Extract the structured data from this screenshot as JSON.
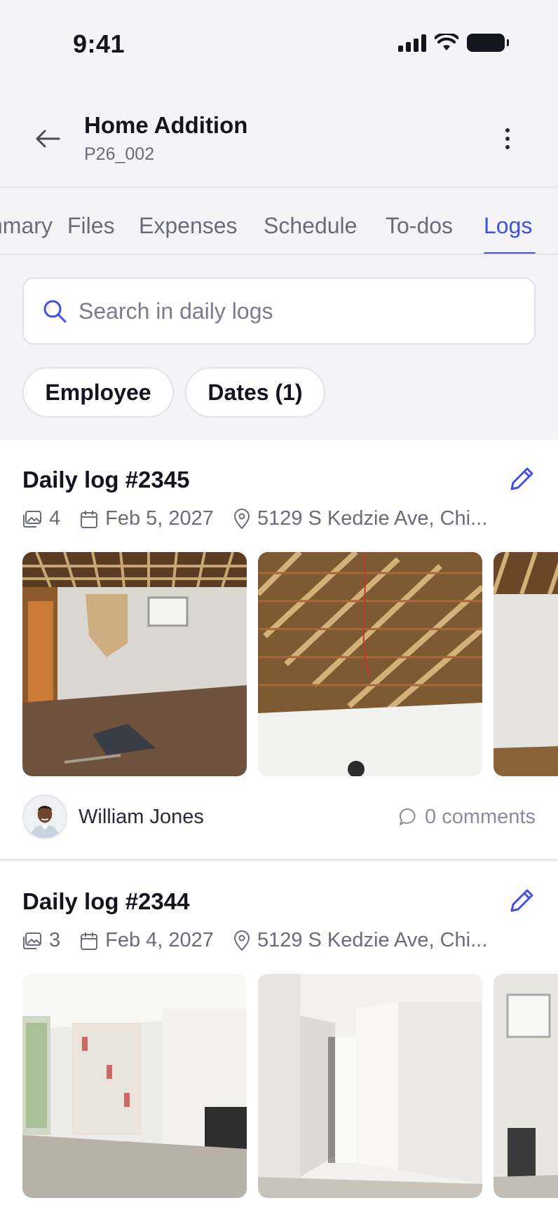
{
  "status_bar": {
    "time": "9:41"
  },
  "header": {
    "title": "Home Addition",
    "subtitle": "P26_002"
  },
  "tabs": [
    {
      "label": "Summary",
      "active": false
    },
    {
      "label": "Files",
      "active": false
    },
    {
      "label": "Expenses",
      "active": false
    },
    {
      "label": "Schedule",
      "active": false
    },
    {
      "label": "To-dos",
      "active": false
    },
    {
      "label": "Logs",
      "active": true
    }
  ],
  "search": {
    "placeholder": "Search in daily logs",
    "value": ""
  },
  "filters": {
    "employee_label": "Employee",
    "dates_label": "Dates (1)"
  },
  "logs": [
    {
      "title": "Daily log #2345",
      "photo_count": "4",
      "date": "Feb 5, 2027",
      "address": "5129 S Kedzie Ave, Chi...",
      "author": "William Jones",
      "comments": "0 comments"
    },
    {
      "title": "Daily log #2344",
      "photo_count": "3",
      "date": "Feb 4, 2027",
      "address": "5129 S Kedzie Ave, Chi..."
    }
  ],
  "colors": {
    "accent": "#4150e0",
    "muted_text": "#6b6c7b",
    "background": "#f3f3f8"
  }
}
